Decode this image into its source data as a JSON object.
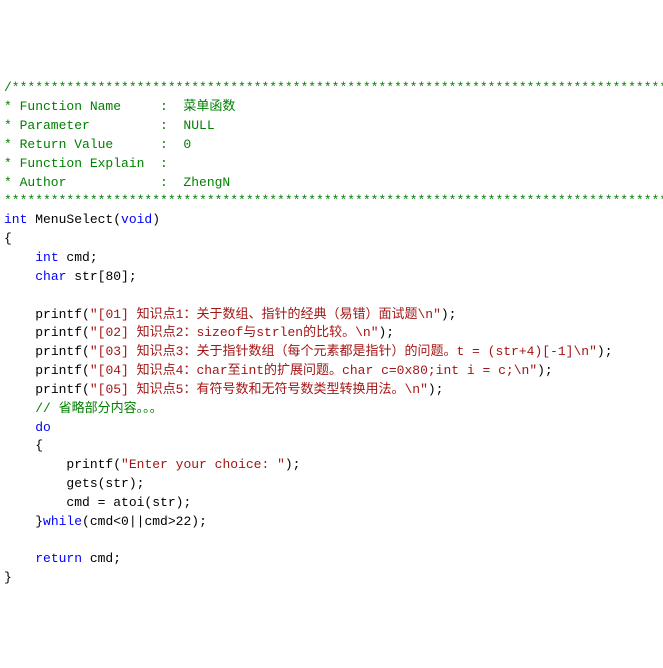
{
  "header": {
    "stars_open": "/****************************************************************************************",
    "l_fn": "* Function Name     :  菜单函数",
    "l_par": "* Parameter         :  NULL",
    "l_ret": "* Return Value      :  0",
    "l_exp": "* Function Explain  :",
    "l_auth": "* Author            :  ZhengN",
    "stars_close": "****************************************************************************************/"
  },
  "code": {
    "kw_int": "int",
    "func_name": " MenuSelect(",
    "kw_void": "void",
    "paren_close": ")",
    "brace_open": "{",
    "brace_close": "}",
    "decl_cmd_pre": " cmd;",
    "kw_char": "char",
    "decl_str": " str[80];",
    "printf": "printf",
    "p1": "(",
    "p2": ");",
    "p1_str": "\"[01] 知识点1：关于数组、指针的经典（易错）面试题",
    "esc_n": "\\n",
    "q_close": "\"",
    "p2_str": "\"[02] 知识点2：sizeof与strlen的比较。",
    "p3_str": "\"[03] 知识点3：关于指针数组（每个元素都是指针）的问题。t = (str+4)[-1]",
    "p4_str": "\"[04] 知识点4：char至int的扩展问题。char c=0x80;int i = c;",
    "p5_str": "\"[05] 知识点5：有符号数和无符号数类型转换用法。",
    "omit_comment": "// 省略部分内容。。。",
    "kw_do": "do",
    "inner_open": "{",
    "prompt_str": "\"Enter your choice: \"",
    "gets_call": "gets(str);",
    "atoi_call": "cmd = atoi(str);",
    "inner_close": "}",
    "kw_while": "while",
    "while_cond": "(cmd<0||cmd>22);",
    "kw_return": "return",
    "return_expr": " cmd;"
  }
}
